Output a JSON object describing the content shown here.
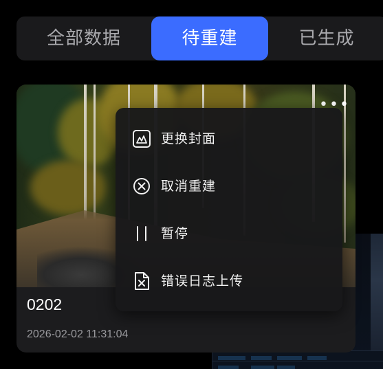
{
  "tabs": [
    {
      "label": "全部数据",
      "active": false
    },
    {
      "label": "待重建",
      "active": true
    },
    {
      "label": "已生成",
      "active": false
    }
  ],
  "colors": {
    "accent": "#3b6cff",
    "background": "#000000",
    "card": "#1c1c1e",
    "menu": "#18181a"
  },
  "card": {
    "title": "0202",
    "date": "2026-02-02 11:31:04",
    "more_icon": "more-horizontal-icon"
  },
  "menu": {
    "items": [
      {
        "label": "更换封面",
        "icon": "image-icon"
      },
      {
        "label": "取消重建",
        "icon": "cancel-circle-icon"
      },
      {
        "label": "暂停",
        "icon": "pause-icon"
      },
      {
        "label": "错误日志上传",
        "icon": "file-error-icon"
      }
    ]
  }
}
